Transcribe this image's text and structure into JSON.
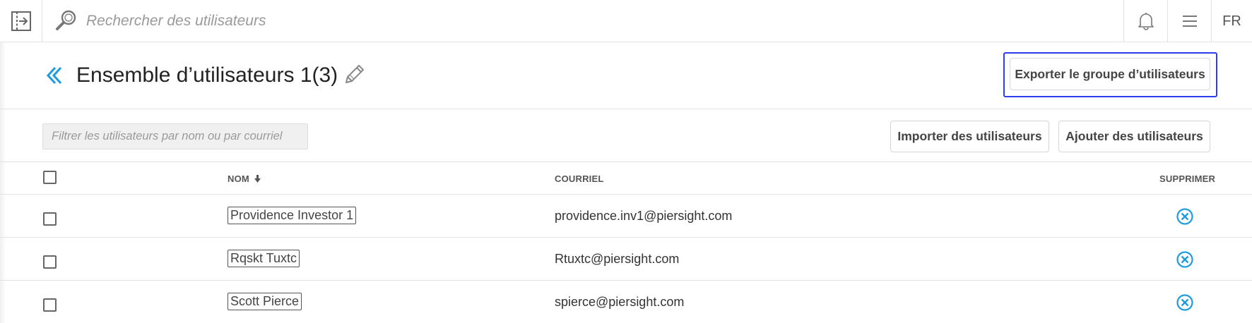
{
  "topbar": {
    "search_placeholder": "Rechercher des utilisateurs",
    "language": "FR"
  },
  "header": {
    "title": "Ensemble d’utilisateurs 1(3)",
    "export_label": "Exporter le groupe d’utilisateurs"
  },
  "filter": {
    "placeholder": "Filtrer les utilisateurs par nom ou par courriel",
    "import_label": "Importer des utilisateurs",
    "add_label": "Ajouter des utilisateurs"
  },
  "table": {
    "columns": {
      "name": "NOM",
      "email": "COURRIEL",
      "delete": "SUPPRIMER"
    },
    "rows": [
      {
        "name": "Providence Investor 1",
        "email": "providence.inv1@piersight.com"
      },
      {
        "name": "Rqskt Tuxtc",
        "email": "Rtuxtc@piersight.com"
      },
      {
        "name": "Scott Pierce",
        "email": "spierce@piersight.com"
      }
    ]
  },
  "colors": {
    "accent": "#1e9be0",
    "focus_ring": "#2e3dec"
  },
  "icons": {
    "sidebar_toggle": "sidebar-expand-icon",
    "search": "search-icon",
    "bell": "bell-icon",
    "menu": "hamburger-menu-icon",
    "back": "double-chevron-left-icon",
    "edit": "pencil-icon",
    "sort": "arrow-down-icon",
    "delete": "circle-x-icon"
  }
}
